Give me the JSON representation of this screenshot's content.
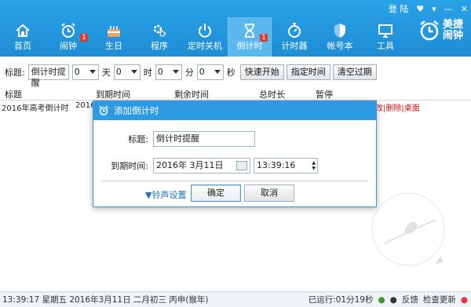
{
  "window": {
    "login": "登 陆",
    "controls": [
      "♥",
      "▾",
      "—",
      "✕"
    ]
  },
  "toolbar": {
    "items": [
      {
        "label": "首页",
        "icon": "home-icon"
      },
      {
        "label": "闹钟",
        "icon": "alarm-clock-icon",
        "badge": "1"
      },
      {
        "label": "生日",
        "icon": "birthday-cake-icon"
      },
      {
        "label": "程序",
        "icon": "gears-icon"
      },
      {
        "label": "定时关机",
        "icon": "power-icon"
      },
      {
        "label": "倒计时",
        "icon": "hourglass-icon",
        "badge": "1",
        "active": true
      },
      {
        "label": "计时器",
        "icon": "stopwatch-icon"
      },
      {
        "label": "帐号本",
        "icon": "shield-icon"
      },
      {
        "label": "工具",
        "icon": "monitor-icon"
      }
    ]
  },
  "brand": {
    "line1": "美捷",
    "line2": "闹钟"
  },
  "controls": {
    "title_label": "标题:",
    "title_value": "倒计时提醒",
    "day_value": "0",
    "day_unit": "天",
    "hour_value": "0",
    "hour_unit": "时",
    "minute_value": "0",
    "minute_unit": "分",
    "second_value": "0",
    "second_unit": "秒",
    "quick_start": "快速开始",
    "set_time": "指定时间",
    "clear_expired": "清空过期"
  },
  "table": {
    "headers": [
      "标题",
      "到期时间",
      "剩余时间",
      "总时长",
      "暂停"
    ],
    "rows": [
      {
        "title": "2016年高考倒计时",
        "due": "2016-",
        "actions": "改|删除|桌面"
      }
    ]
  },
  "dialog": {
    "title": "添加倒计时",
    "title_label": "标题:",
    "title_value": "倒计时提醒",
    "due_label": "到期时间:",
    "date_value": "2016年  3月11日",
    "time_value": "13:39:16",
    "ringtone": "▼铃声设置",
    "ok": "确定",
    "cancel": "取消"
  },
  "status": {
    "datetime": "13:39:17 星期五 2016年3月11日 二月初三 丙申(猴年)",
    "uptime": "已运行:01分19秒",
    "feedback": "反馈",
    "update": "检查更新"
  },
  "colors": {
    "toolbar": "#2aa2e6",
    "accent": "#2d9be3",
    "action": "#d8140e"
  }
}
